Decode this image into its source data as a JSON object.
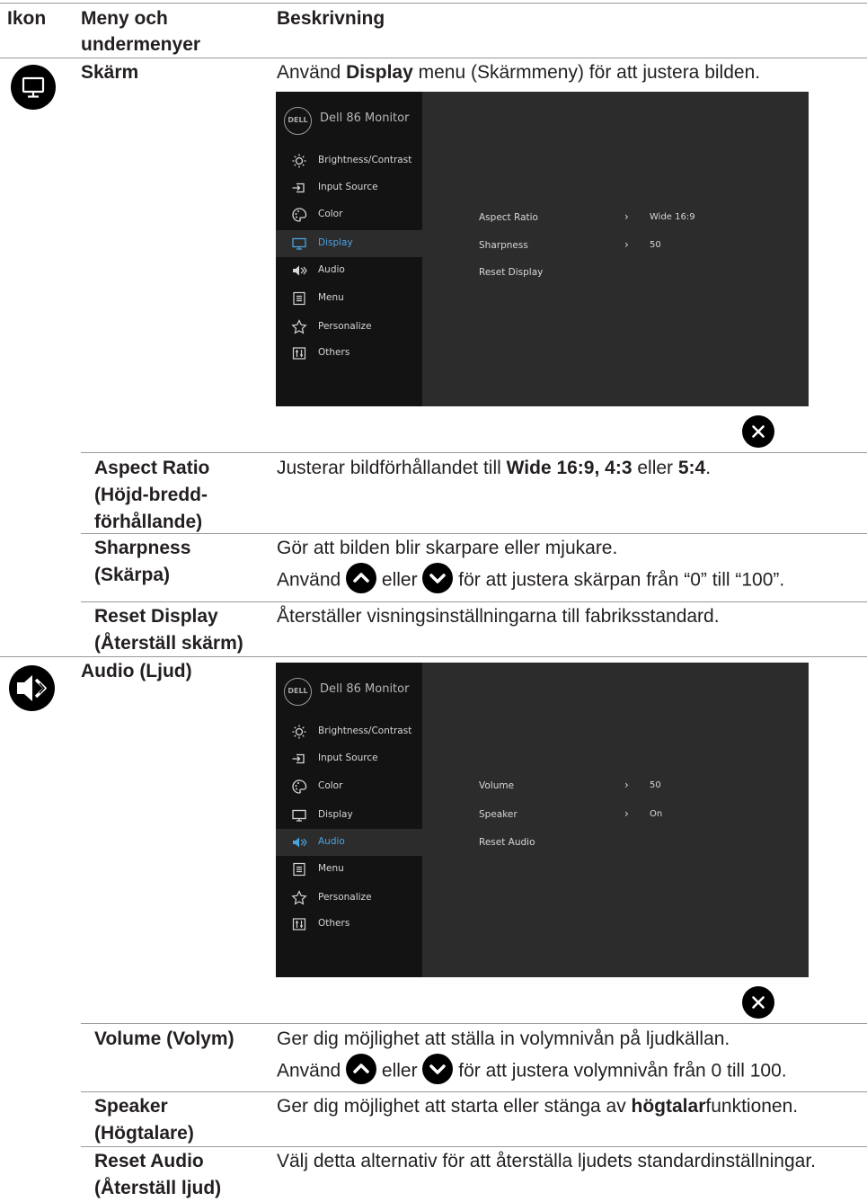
{
  "header": {
    "col1": "Ikon",
    "col2a": "Meny och",
    "col2b": "undermenyer",
    "col3": "Beskrivning"
  },
  "display": {
    "title": "Skärm",
    "desc_pre": "Använd ",
    "desc_bold": "Display",
    "desc_post": " menu (Skärmmeny) för att justera bilden.",
    "osd": {
      "logo": "DELL",
      "monitor": "Dell 86 Monitor",
      "menu": [
        "Brightness/Contrast",
        "Input Source",
        "Color",
        "Display",
        "Audio",
        "Menu",
        "Personalize",
        "Others"
      ],
      "options": [
        "Aspect Ratio",
        "Sharpness",
        "Reset Display"
      ],
      "values": [
        "Wide 16:9",
        "50"
      ]
    },
    "aspect": {
      "l1": "Aspect Ratio",
      "l2": "(Höjd-bredd-",
      "l3": "förhållande)",
      "d_pre": "Justerar bildförhållandet till ",
      "d_b1": "Wide 16:9, 4:3",
      "d_mid": " eller ",
      "d_b2": "5:4",
      "d_end": "."
    },
    "sharp": {
      "l1": "Sharpness",
      "l2": "(Skärpa)",
      "d1": "Gör att bilden blir skarpare eller mjukare.",
      "d2a": "Använd ",
      "d2b": " eller ",
      "d2c": " för att justera skärpan från “0” till “100”."
    },
    "reset": {
      "l1": "Reset Display",
      "l2": "(Återställ skärm)",
      "d": "Återställer visningsinställningarna till fabriksstandard."
    }
  },
  "audio": {
    "title": "Audio (Ljud)",
    "osd": {
      "logo": "DELL",
      "monitor": "Dell 86 Monitor",
      "menu": [
        "Brightness/Contrast",
        "Input Source",
        "Color",
        "Display",
        "Audio",
        "Menu",
        "Personalize",
        "Others"
      ],
      "options": [
        "Volume",
        "Speaker",
        "Reset Audio"
      ],
      "values": [
        "50",
        "On"
      ]
    },
    "volume": {
      "l1": "Volume (Volym)",
      "d1": "Ger dig möjlighet att ställa in volymnivån på ljudkällan.",
      "d2a": "Använd ",
      "d2b": " eller ",
      "d2c": " för att justera volymnivån från 0 till 100."
    },
    "speaker": {
      "l1": "Speaker",
      "l2": "(Högtalare)",
      "d_pre": "Ger dig möjlighet att starta eller stänga av ",
      "d_b": "högtalar",
      "d_post": "funktionen."
    },
    "reset": {
      "l1": "Reset Audio",
      "l2": "(Återställ ljud)",
      "d": "Välj detta alternativ för att återställa ljudets standardinställningar."
    }
  }
}
